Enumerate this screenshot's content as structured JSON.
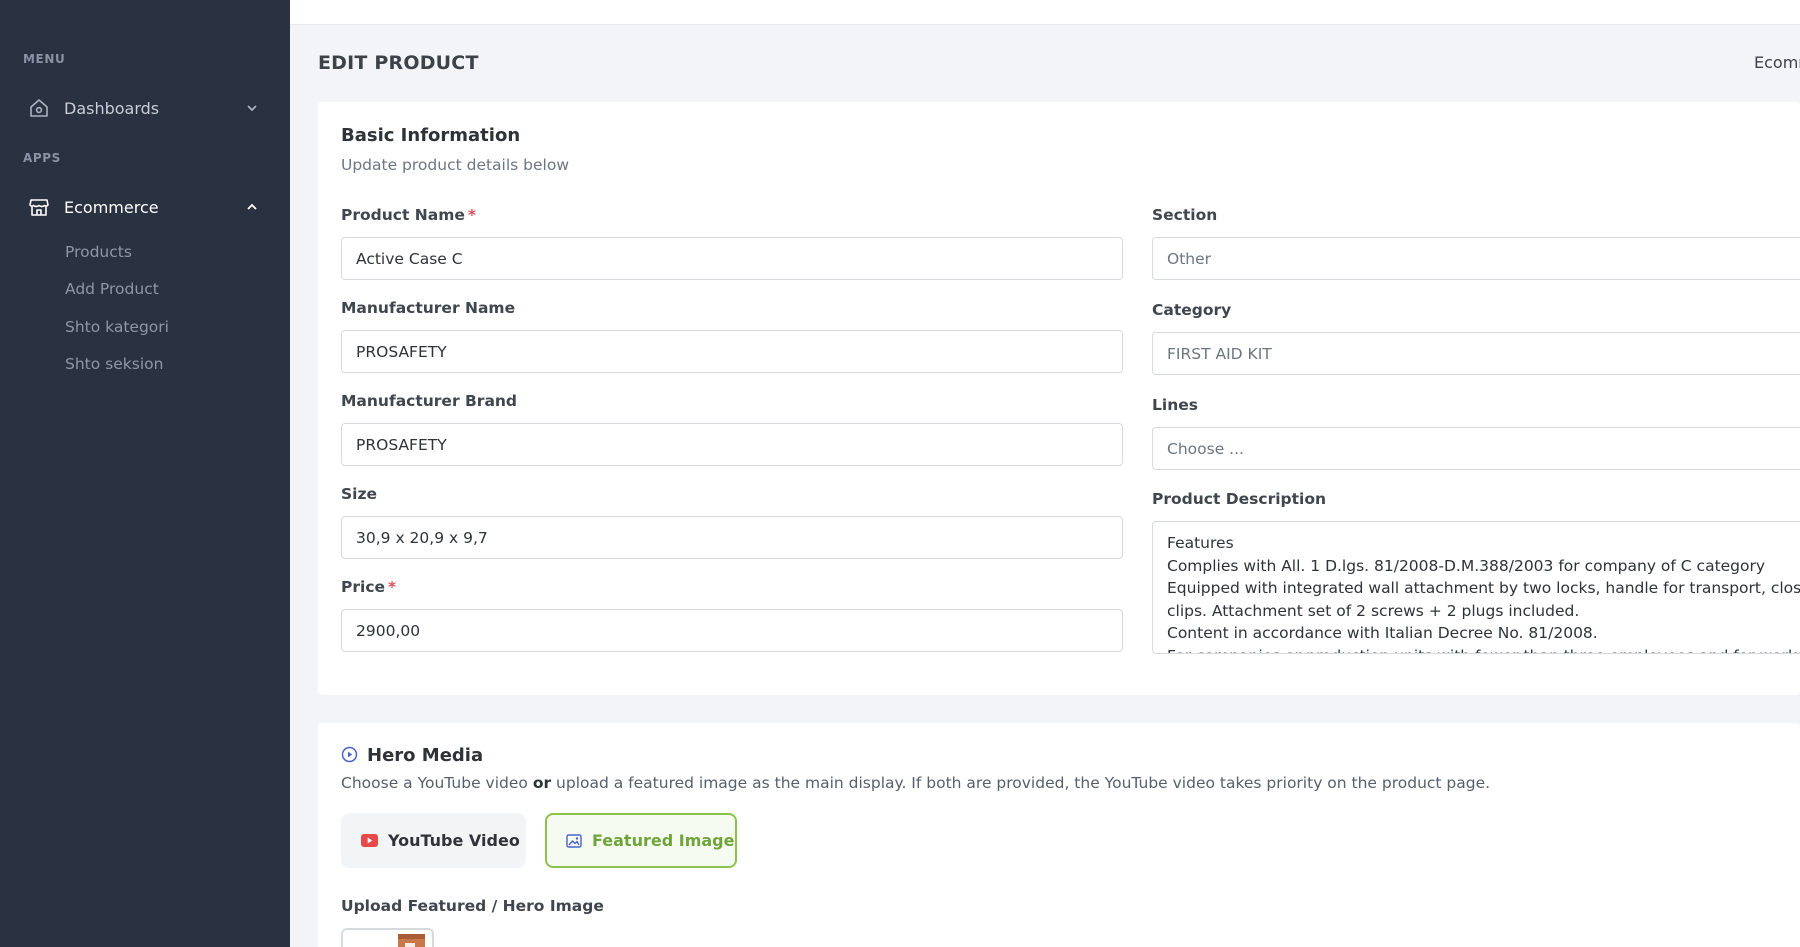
{
  "sidebar": {
    "menu_heading": "MENU",
    "apps_heading": "APPS",
    "dashboards": {
      "label": "Dashboards",
      "icon": "home-icon"
    },
    "ecommerce": {
      "label": "Ecommerce",
      "icon": "store-icon"
    },
    "submenu": [
      "Products",
      "Add Product",
      "Shto kategori",
      "Shto seksion"
    ]
  },
  "header": {
    "title": "EDIT PRODUCT",
    "breadcrumb": "Ecommerce"
  },
  "basic_info": {
    "title": "Basic Information",
    "subtitle": "Update product details below",
    "product_name": {
      "label": "Product Name",
      "required": "*",
      "value": "Active Case C"
    },
    "manufacturer_name": {
      "label": "Manufacturer Name",
      "value": "PROSAFETY"
    },
    "manufacturer_brand": {
      "label": "Manufacturer Brand",
      "value": "PROSAFETY"
    },
    "size": {
      "label": "Size",
      "value": "30,9 x 20,9 x 9,7"
    },
    "price": {
      "label": "Price",
      "required": "*",
      "value": "2900,00"
    },
    "section": {
      "label": "Section",
      "value": "Other"
    },
    "category": {
      "label": "Category",
      "value": "FIRST AID KIT"
    },
    "lines": {
      "label": "Lines",
      "value": "Choose ..."
    },
    "description": {
      "label": "Product Description",
      "lines": [
        "Features",
        "Complies with All. 1  D.lgs. 81/2008-D.M.388/2003 for company of C category",
        "Equipped with integrated wall attachment by two locks, handle for transport, closure",
        "clips. Attachment set of 2 screws + 2 plugs included.",
        "Content in accordance with Italian Decree No. 81/2008.",
        "For companies or production units with fewer than three employees and for workers"
      ]
    }
  },
  "hero_media": {
    "title": "Hero Media",
    "desc_before": "Choose a YouTube video ",
    "desc_bold": "or",
    "desc_after": " upload a featured image as the main display. If both are provided, the YouTube video takes priority on the product page.",
    "youtube_label": "YouTube Video",
    "featured_label": "Featured Image",
    "upload_label": "Upload Featured / Hero Image"
  },
  "colors": {
    "sidebar_bg": "#2a3140",
    "accent_green": "#8bc34a",
    "youtube_red": "#e84a4a",
    "required_red": "#e0505a"
  }
}
